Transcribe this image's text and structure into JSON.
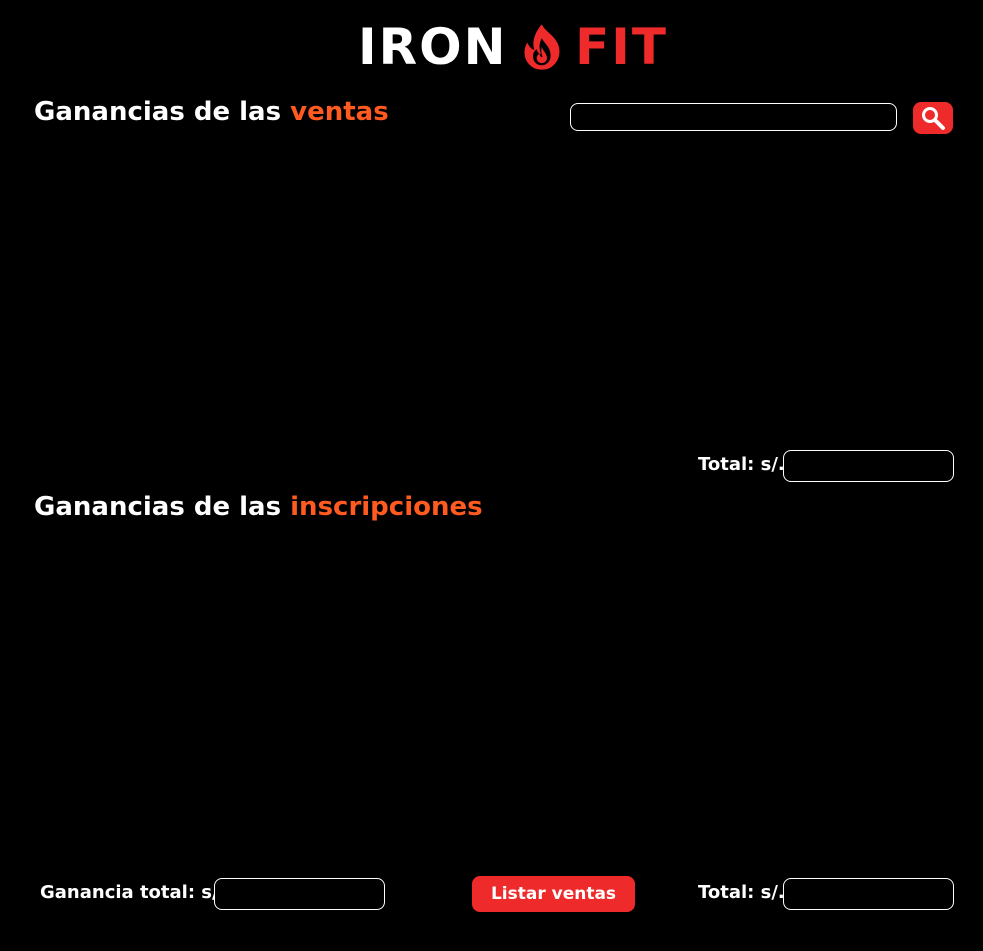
{
  "brand": {
    "left": "IRON",
    "right": "FIT",
    "icon": "flame-icon",
    "colors": {
      "accent": "#ee2a2a",
      "highlight": "#ff5a1f",
      "background": "#000000",
      "text": "#ffffff"
    }
  },
  "ventas": {
    "title_prefix": "Ganancias de las ",
    "title_accent": "ventas",
    "search": {
      "value": "",
      "placeholder": ""
    },
    "search_icon": "search-icon",
    "total_label": "Total: s/.",
    "total_value": ""
  },
  "inscripciones": {
    "title_prefix": "Ganancias de las ",
    "title_accent": "inscripciones",
    "total_label": "Total: s/.",
    "total_value": ""
  },
  "footer": {
    "ganancia_label": "Ganancia total: s/.",
    "ganancia_value": "",
    "listar_label": "Listar ventas"
  }
}
